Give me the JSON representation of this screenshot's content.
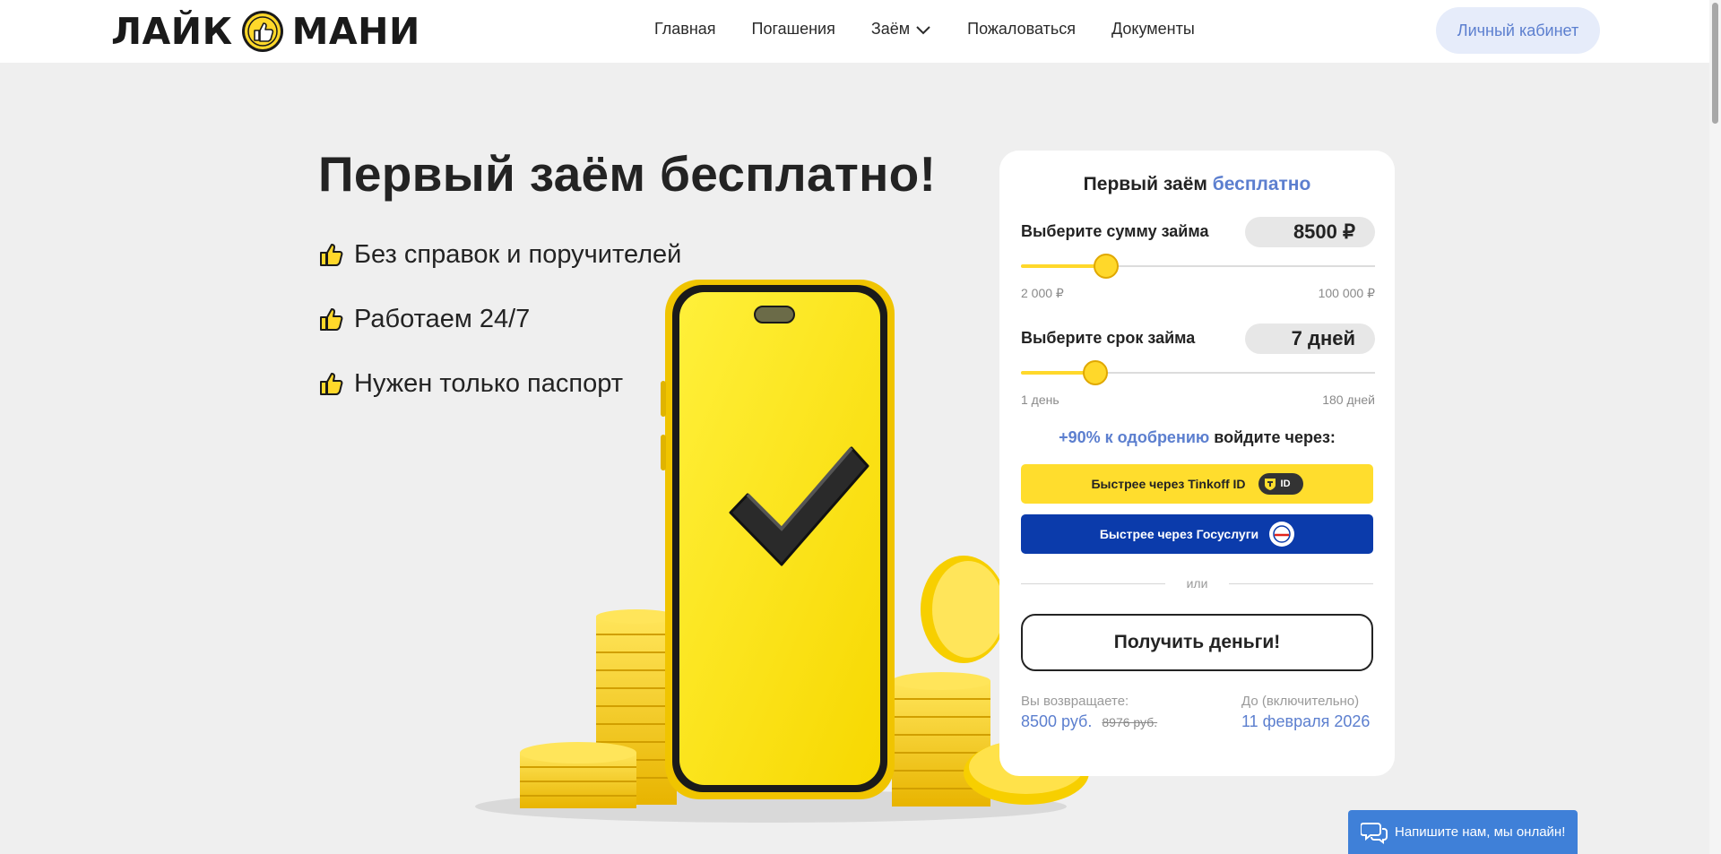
{
  "header": {
    "logo_left": "ЛАЙК",
    "logo_right": "МАНИ",
    "nav": [
      {
        "label": "Главная"
      },
      {
        "label": "Погашения"
      },
      {
        "label": "Заём"
      },
      {
        "label": "Пожаловаться"
      },
      {
        "label": "Документы"
      }
    ],
    "cabinet_label": "Личный кабинет"
  },
  "hero": {
    "title": "Первый заём бесплатно!",
    "features": [
      "Без справок и поручителей",
      "Работаем 24/7",
      "Нужен только паспорт"
    ]
  },
  "form": {
    "title_plain": "Первый заём",
    "title_accent": "бесплатно",
    "amount": {
      "label": "Выберите сумму займа",
      "value": "8500 ₽",
      "min_label": "2 000 ₽",
      "max_label": "100 000 ₽",
      "min": 2000,
      "max": 100000,
      "current": 8500,
      "slider_fraction": 0.24
    },
    "term": {
      "label": "Выберите срок займа",
      "value": "7 дней",
      "min_label": "1 день",
      "max_label": "180 дней",
      "min": 1,
      "max": 180,
      "current": 7,
      "slider_fraction": 0.21
    },
    "approval_accent": "+90% к одобрению",
    "approval_plain": "войдите через:",
    "tinkoff_label": "Быстрее через Tinkoff ID",
    "tinkoff_badge": "ID",
    "gos_label": "Быстрее через Госуслуги",
    "or_label": "или",
    "get_money_label": "Получить деньги!",
    "return_label": "Вы возвращаете:",
    "return_value": "8500 руб.",
    "return_old": "8976 руб.",
    "until_label": "До (включительно)",
    "until_value": "11 февраля 2026"
  },
  "chat": {
    "label": "Напишите нам, мы онлайн!"
  },
  "colors": {
    "accent_blue": "#5c7fcf",
    "brand_yellow": "#ffd82a",
    "gos_blue": "#0b3bab",
    "chat_blue": "#3f80d8"
  }
}
